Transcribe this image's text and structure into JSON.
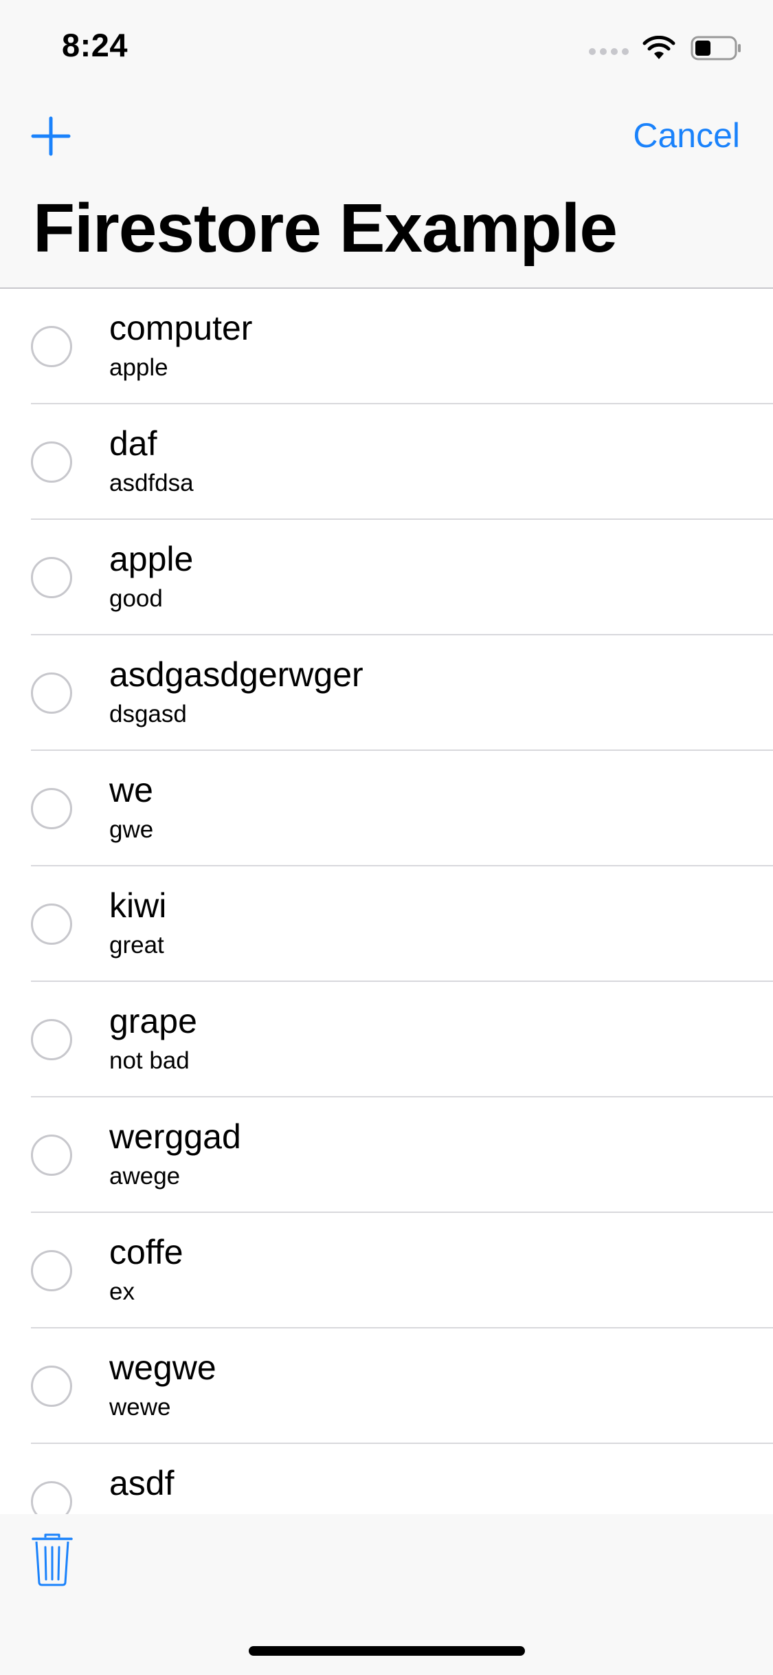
{
  "status_bar": {
    "time": "8:24"
  },
  "nav": {
    "add_icon": "plus-icon",
    "cancel_label": "Cancel",
    "title": "Firestore Example"
  },
  "colors": {
    "accent": "#1a82fb",
    "bar_background": "#f8f8f8",
    "separator": "#d8d8dc",
    "radio_border": "#c7c7cc"
  },
  "list": {
    "items": [
      {
        "title": "computer",
        "subtitle": "apple"
      },
      {
        "title": "daf",
        "subtitle": "asdfdsa"
      },
      {
        "title": "apple",
        "subtitle": "good"
      },
      {
        "title": "asdgasdgerwger",
        "subtitle": "dsgasd"
      },
      {
        "title": "we",
        "subtitle": "gwe"
      },
      {
        "title": "kiwi",
        "subtitle": "great"
      },
      {
        "title": "grape",
        "subtitle": "not bad"
      },
      {
        "title": "werggad",
        "subtitle": "awege"
      },
      {
        "title": "coffe",
        "subtitle": "ex"
      },
      {
        "title": "wegwe",
        "subtitle": "wewe"
      },
      {
        "title": "asdf",
        "subtitle": ""
      }
    ]
  },
  "toolbar": {
    "trash_icon": "trash-icon"
  }
}
